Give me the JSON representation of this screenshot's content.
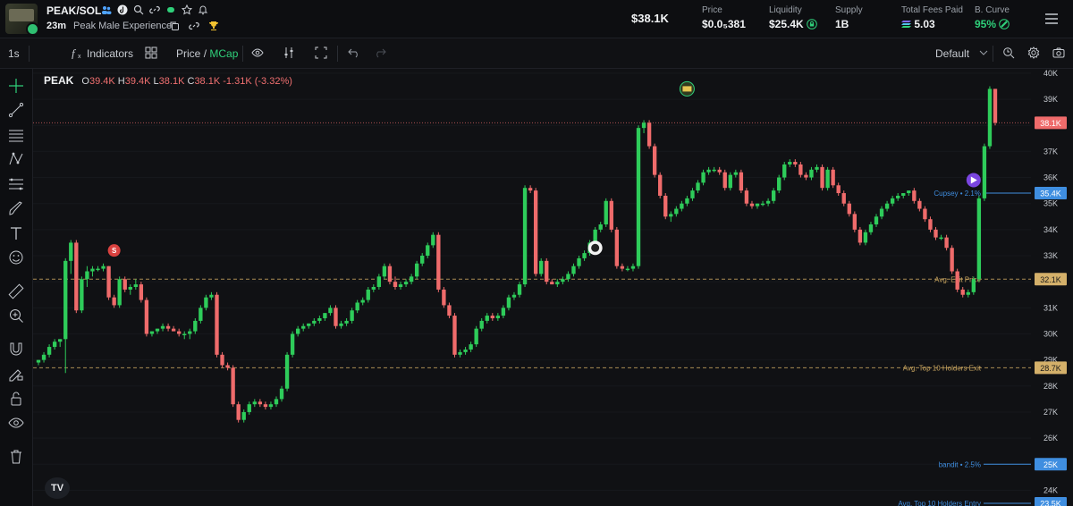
{
  "token": {
    "pair": "PEAK/SOL",
    "age": "23m",
    "name": "Peak Male Experience"
  },
  "header": {
    "market_cap": "$38.1K",
    "stats": [
      {
        "label": "Price",
        "value": "$0.0₅381"
      },
      {
        "label": "Liquidity",
        "value": "$25.4K"
      },
      {
        "label": "Supply",
        "value": "1B"
      },
      {
        "label": "Total Fees Paid",
        "value": "5.03"
      },
      {
        "label": "B. Curve",
        "value": "95%"
      }
    ]
  },
  "toolbar": {
    "interval": "1s",
    "indicators_label": "Indicators",
    "price_label": "Price",
    "slash": "/",
    "mcap_label": "MCap",
    "layout_label": "Default"
  },
  "legend": {
    "symbol": "PEAK",
    "o_label": "O",
    "o_value": "39.4K",
    "h_label": "H",
    "h_value": "39.4K",
    "l_label": "L",
    "l_value": "38.1K",
    "c_label": "C",
    "c_value": "38.1K",
    "change": "-1.31K (-3.32%)"
  },
  "colors": {
    "up": "#2ecc5a",
    "down": "#ef6b6b",
    "accent": "#2fd07a",
    "blue_tag": "#3f8ee0",
    "gold": "#c5a25e"
  },
  "chart_data": {
    "type": "candlestick",
    "y_axis_labels": [
      "40K",
      "39K",
      "38.1K",
      "37K",
      "36K",
      "35.4K",
      "35K",
      "34K",
      "33K",
      "32.1K",
      "31K",
      "30K",
      "29K",
      "28.7K",
      "28K",
      "27K",
      "26K",
      "25K",
      "24K",
      "23.5K"
    ],
    "ylim": [
      23.5,
      40.1
    ],
    "current_price": 38.1,
    "lines": [
      {
        "name": "Cupsey • 2.1%",
        "value": 35.4,
        "tag": "35.4K",
        "style": "solid",
        "color": "#3f8ee0"
      },
      {
        "name": "Avg. Exit Price",
        "value": 32.1,
        "tag": "32.1K",
        "style": "dashed",
        "color": "#c5a25e"
      },
      {
        "name": "Avg. Top 10 Holders Exit",
        "value": 28.7,
        "tag": "28.7K",
        "style": "dashed",
        "color": "#c5a25e"
      },
      {
        "name": "bandit • 2.5%",
        "value": 25.0,
        "tag": "25K",
        "style": "solid",
        "color": "#3f8ee0"
      },
      {
        "name": "Avg. Top 10 Holders Entry",
        "value": 23.5,
        "tag": "23.5K",
        "style": "solid",
        "color": "#3f8ee0"
      }
    ],
    "markers": [
      {
        "label": "S",
        "kind": "sell",
        "x_index": 14,
        "value": 33.2
      },
      {
        "label": "",
        "kind": "buy",
        "x_index": 103,
        "value": 33.3
      },
      {
        "label": "",
        "kind": "dev",
        "x_index": 120,
        "value": 39.4
      },
      {
        "label": "",
        "kind": "pump",
        "x_index": 173,
        "value": 35.9
      }
    ],
    "candles": [
      [
        28.9,
        29.0,
        28.8,
        29.0
      ],
      [
        29.0,
        29.3,
        28.9,
        29.2
      ],
      [
        29.2,
        29.6,
        29.1,
        29.5
      ],
      [
        29.5,
        29.8,
        29.4,
        29.7
      ],
      [
        29.7,
        29.8,
        29.5,
        29.8
      ],
      [
        29.8,
        32.9,
        28.5,
        32.8
      ],
      [
        32.8,
        33.6,
        32.3,
        33.5
      ],
      [
        33.5,
        33.6,
        30.8,
        30.9
      ],
      [
        30.9,
        32.2,
        30.8,
        32.1
      ],
      [
        32.1,
        32.6,
        31.8,
        32.4
      ],
      [
        32.4,
        32.6,
        32.2,
        32.5
      ],
      [
        32.5,
        32.6,
        32.4,
        32.5
      ],
      [
        32.5,
        32.7,
        32.4,
        32.6
      ],
      [
        32.6,
        32.6,
        31.3,
        31.4
      ],
      [
        31.4,
        31.5,
        31.0,
        31.1
      ],
      [
        31.1,
        32.2,
        31.0,
        32.1
      ],
      [
        32.1,
        32.2,
        31.6,
        31.7
      ],
      [
        31.7,
        31.9,
        31.5,
        31.8
      ],
      [
        31.8,
        32.1,
        31.7,
        31.9
      ],
      [
        31.9,
        32.0,
        31.2,
        31.3
      ],
      [
        31.3,
        31.4,
        29.9,
        30.0
      ],
      [
        30.0,
        30.1,
        29.9,
        30.1
      ],
      [
        30.1,
        30.2,
        30.0,
        30.2
      ],
      [
        30.2,
        30.4,
        30.1,
        30.3
      ],
      [
        30.3,
        30.4,
        30.1,
        30.2
      ],
      [
        30.2,
        30.3,
        30.1,
        30.1
      ],
      [
        30.1,
        30.2,
        29.9,
        30.0
      ],
      [
        30.0,
        30.1,
        29.8,
        30.0
      ],
      [
        30.0,
        30.2,
        29.8,
        30.1
      ],
      [
        30.1,
        30.6,
        30.0,
        30.5
      ],
      [
        30.5,
        31.1,
        30.4,
        31.0
      ],
      [
        31.0,
        31.5,
        30.9,
        31.4
      ],
      [
        31.4,
        31.6,
        31.3,
        31.5
      ],
      [
        31.5,
        31.6,
        29.1,
        29.2
      ],
      [
        29.2,
        29.3,
        28.7,
        28.8
      ],
      [
        28.8,
        28.9,
        28.6,
        28.7
      ],
      [
        28.7,
        28.8,
        27.2,
        27.3
      ],
      [
        27.3,
        27.4,
        26.6,
        26.7
      ],
      [
        26.7,
        27.1,
        26.6,
        27.0
      ],
      [
        27.0,
        27.4,
        26.9,
        27.3
      ],
      [
        27.3,
        27.5,
        27.2,
        27.4
      ],
      [
        27.4,
        27.5,
        27.2,
        27.3
      ],
      [
        27.3,
        27.4,
        27.1,
        27.2
      ],
      [
        27.2,
        27.4,
        27.1,
        27.3
      ],
      [
        27.3,
        27.6,
        27.2,
        27.5
      ],
      [
        27.5,
        28.0,
        27.4,
        27.9
      ],
      [
        27.9,
        29.3,
        27.8,
        29.2
      ],
      [
        29.2,
        30.1,
        29.1,
        30.0
      ],
      [
        30.0,
        30.3,
        29.9,
        30.2
      ],
      [
        30.2,
        30.4,
        30.1,
        30.3
      ],
      [
        30.3,
        30.4,
        30.2,
        30.4
      ],
      [
        30.4,
        30.6,
        30.3,
        30.5
      ],
      [
        30.5,
        30.7,
        30.4,
        30.6
      ],
      [
        30.6,
        30.8,
        30.5,
        30.8
      ],
      [
        30.8,
        31.1,
        30.7,
        31.0
      ],
      [
        31.0,
        31.1,
        30.2,
        30.3
      ],
      [
        30.3,
        30.5,
        30.2,
        30.4
      ],
      [
        30.4,
        30.6,
        30.3,
        30.5
      ],
      [
        30.5,
        31.0,
        30.4,
        30.9
      ],
      [
        30.9,
        31.3,
        30.8,
        31.2
      ],
      [
        31.2,
        31.4,
        31.1,
        31.3
      ],
      [
        31.3,
        31.8,
        31.2,
        31.7
      ],
      [
        31.7,
        31.9,
        31.6,
        31.8
      ],
      [
        31.8,
        32.3,
        31.7,
        32.2
      ],
      [
        32.2,
        32.7,
        32.1,
        32.6
      ],
      [
        32.6,
        32.7,
        31.9,
        32.0
      ],
      [
        32.0,
        32.2,
        31.7,
        31.8
      ],
      [
        31.8,
        32.0,
        31.7,
        31.9
      ],
      [
        31.9,
        32.1,
        31.8,
        32.0
      ],
      [
        32.0,
        32.3,
        31.9,
        32.2
      ],
      [
        32.2,
        32.8,
        32.1,
        32.7
      ],
      [
        32.7,
        33.1,
        32.6,
        33.0
      ],
      [
        33.0,
        33.5,
        32.9,
        33.4
      ],
      [
        33.4,
        33.9,
        33.3,
        33.8
      ],
      [
        33.8,
        33.9,
        31.6,
        31.7
      ],
      [
        31.7,
        31.8,
        31.0,
        31.1
      ],
      [
        31.1,
        31.2,
        30.6,
        30.7
      ],
      [
        30.7,
        30.8,
        29.1,
        29.2
      ],
      [
        29.2,
        29.4,
        29.1,
        29.3
      ],
      [
        29.3,
        29.5,
        29.2,
        29.4
      ],
      [
        29.4,
        29.7,
        29.3,
        29.6
      ],
      [
        29.6,
        30.3,
        29.5,
        30.2
      ],
      [
        30.2,
        30.6,
        30.1,
        30.5
      ],
      [
        30.5,
        30.8,
        30.4,
        30.7
      ],
      [
        30.7,
        30.8,
        30.5,
        30.6
      ],
      [
        30.6,
        30.8,
        30.5,
        30.7
      ],
      [
        30.7,
        31.1,
        30.6,
        31.0
      ],
      [
        31.0,
        31.5,
        30.9,
        31.4
      ],
      [
        31.4,
        31.6,
        31.3,
        31.5
      ],
      [
        31.5,
        32.0,
        31.4,
        31.9
      ],
      [
        31.9,
        35.7,
        31.8,
        35.6
      ],
      [
        35.6,
        35.7,
        35.4,
        35.5
      ],
      [
        35.5,
        35.6,
        32.2,
        32.3
      ],
      [
        32.3,
        32.9,
        32.2,
        32.8
      ],
      [
        32.8,
        32.9,
        31.9,
        32.0
      ],
      [
        32.0,
        32.1,
        31.9,
        31.9
      ],
      [
        31.9,
        32.1,
        31.8,
        32.0
      ],
      [
        32.0,
        32.2,
        31.9,
        32.1
      ],
      [
        32.1,
        32.4,
        32.0,
        32.3
      ],
      [
        32.3,
        32.7,
        32.2,
        32.6
      ],
      [
        32.6,
        33.0,
        32.5,
        32.9
      ],
      [
        32.9,
        33.2,
        32.8,
        33.1
      ],
      [
        33.1,
        33.6,
        33.0,
        33.5
      ],
      [
        33.5,
        34.1,
        33.4,
        34.0
      ],
      [
        34.0,
        34.3,
        33.9,
        34.2
      ],
      [
        34.2,
        35.2,
        34.1,
        35.1
      ],
      [
        35.1,
        35.2,
        33.9,
        34.0
      ],
      [
        34.0,
        34.1,
        32.5,
        32.6
      ],
      [
        32.6,
        32.7,
        32.4,
        32.5
      ],
      [
        32.5,
        32.6,
        32.4,
        32.5
      ],
      [
        32.5,
        32.7,
        32.4,
        32.6
      ],
      [
        32.6,
        38.0,
        32.5,
        37.9
      ],
      [
        37.9,
        38.2,
        37.7,
        38.1
      ],
      [
        38.1,
        38.2,
        37.1,
        37.2
      ],
      [
        37.2,
        37.3,
        36.0,
        36.1
      ],
      [
        36.1,
        36.2,
        35.2,
        35.3
      ],
      [
        35.3,
        35.4,
        34.4,
        34.5
      ],
      [
        34.5,
        34.7,
        34.3,
        34.6
      ],
      [
        34.6,
        34.9,
        34.5,
        34.8
      ],
      [
        34.8,
        35.1,
        34.7,
        35.0
      ],
      [
        35.0,
        35.3,
        34.9,
        35.2
      ],
      [
        35.2,
        35.6,
        35.1,
        35.5
      ],
      [
        35.5,
        35.9,
        35.4,
        35.8
      ],
      [
        35.8,
        36.3,
        35.7,
        36.2
      ],
      [
        36.2,
        36.4,
        36.1,
        36.3
      ],
      [
        36.3,
        36.4,
        36.2,
        36.3
      ],
      [
        36.3,
        36.4,
        36.1,
        36.2
      ],
      [
        36.2,
        36.3,
        35.5,
        35.6
      ],
      [
        35.6,
        36.2,
        35.5,
        36.1
      ],
      [
        36.1,
        36.3,
        36.0,
        36.2
      ],
      [
        36.2,
        36.3,
        35.4,
        35.5
      ],
      [
        35.5,
        35.6,
        34.9,
        35.0
      ],
      [
        35.0,
        35.1,
        34.8,
        34.9
      ],
      [
        34.9,
        35.0,
        34.8,
        35.0
      ],
      [
        35.0,
        35.1,
        34.9,
        35.0
      ],
      [
        35.0,
        35.2,
        34.9,
        35.1
      ],
      [
        35.1,
        35.6,
        35.0,
        35.5
      ],
      [
        35.5,
        36.1,
        35.4,
        36.0
      ],
      [
        36.0,
        36.6,
        35.9,
        36.5
      ],
      [
        36.5,
        36.7,
        36.4,
        36.6
      ],
      [
        36.6,
        36.7,
        36.4,
        36.5
      ],
      [
        36.5,
        36.6,
        36.0,
        36.1
      ],
      [
        36.1,
        36.2,
        35.9,
        36.0
      ],
      [
        36.0,
        36.4,
        35.9,
        36.3
      ],
      [
        36.3,
        36.5,
        36.2,
        36.4
      ],
      [
        36.4,
        36.5,
        35.5,
        35.6
      ],
      [
        35.6,
        36.4,
        35.5,
        36.3
      ],
      [
        36.3,
        36.4,
        35.6,
        35.7
      ],
      [
        35.7,
        35.8,
        35.3,
        35.4
      ],
      [
        35.4,
        35.5,
        34.9,
        35.0
      ],
      [
        35.0,
        35.1,
        34.5,
        34.6
      ],
      [
        34.6,
        34.7,
        33.9,
        34.0
      ],
      [
        34.0,
        34.1,
        33.4,
        33.5
      ],
      [
        33.5,
        34.0,
        33.4,
        33.9
      ],
      [
        33.9,
        34.3,
        33.8,
        34.2
      ],
      [
        34.2,
        34.6,
        34.1,
        34.5
      ],
      [
        34.5,
        34.9,
        34.4,
        34.8
      ],
      [
        34.8,
        35.1,
        34.7,
        35.0
      ],
      [
        35.0,
        35.3,
        34.9,
        35.2
      ],
      [
        35.2,
        35.4,
        35.1,
        35.3
      ],
      [
        35.3,
        35.4,
        35.2,
        35.4
      ],
      [
        35.4,
        35.5,
        35.3,
        35.5
      ],
      [
        35.5,
        35.6,
        35.0,
        35.1
      ],
      [
        35.1,
        35.2,
        34.7,
        34.8
      ],
      [
        34.8,
        34.9,
        34.3,
        34.4
      ],
      [
        34.4,
        34.5,
        33.9,
        34.0
      ],
      [
        34.0,
        34.1,
        33.6,
        33.7
      ],
      [
        33.7,
        33.8,
        33.6,
        33.7
      ],
      [
        33.7,
        33.8,
        33.2,
        33.3
      ],
      [
        33.3,
        33.4,
        32.3,
        32.4
      ],
      [
        32.4,
        32.5,
        31.6,
        31.7
      ],
      [
        31.7,
        31.8,
        31.4,
        31.5
      ],
      [
        31.5,
        31.7,
        31.4,
        31.6
      ],
      [
        31.6,
        32.2,
        31.5,
        32.1
      ],
      [
        32.1,
        35.3,
        32.0,
        35.2
      ],
      [
        35.2,
        37.3,
        35.1,
        37.2
      ],
      [
        37.2,
        39.5,
        37.1,
        39.4
      ],
      [
        39.4,
        39.4,
        38.0,
        38.1
      ]
    ]
  }
}
